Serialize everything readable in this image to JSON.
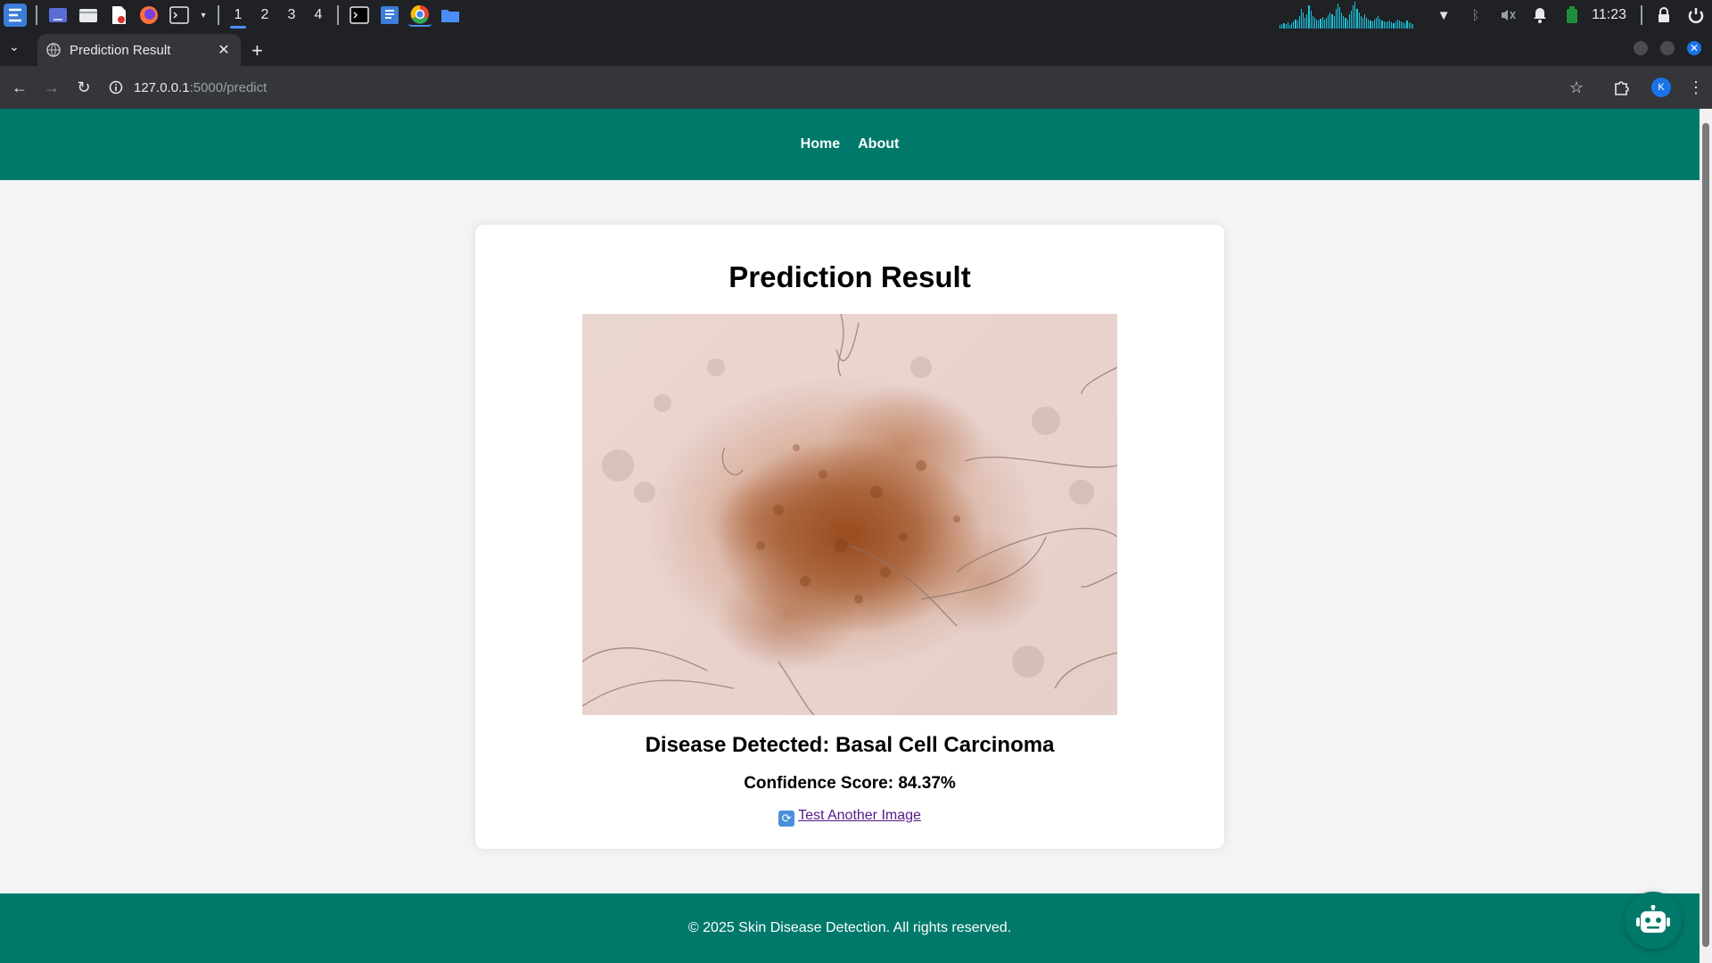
{
  "taskbar": {
    "workspaces": [
      "1",
      "2",
      "3",
      "4"
    ],
    "active_workspace": "1",
    "clock": "11:23"
  },
  "browser": {
    "tab_title": "Prediction Result",
    "url_host": "127.0.0.1",
    "url_path": ":5000/predict",
    "profile_initial": "K"
  },
  "nav": {
    "home": "Home",
    "about": "About"
  },
  "result": {
    "title": "Prediction Result",
    "disease_line": "Disease Detected: Basal Cell Carcinoma",
    "confidence_line": "Confidence Score: 84.37%",
    "retry_link": "Test Another Image"
  },
  "footer": {
    "text": "© 2025 Skin Disease Detection. All rights reserved."
  },
  "colors": {
    "brand": "#00796b",
    "page_bg": "#f4f4f4",
    "link_visited": "#551a8b"
  }
}
